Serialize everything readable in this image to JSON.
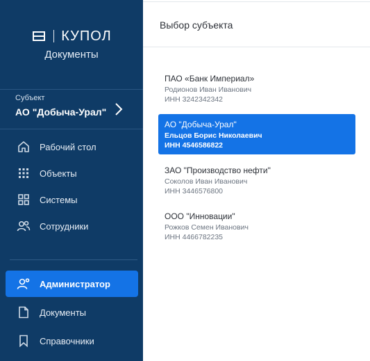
{
  "brand": {
    "name": "КУПОЛ",
    "subtitle": "Документы"
  },
  "subject": {
    "caption": "Субъект",
    "name": "АО \"Добыча-Урал\""
  },
  "nav": {
    "items": [
      {
        "label": "Рабочий стол",
        "icon": "home-icon"
      },
      {
        "label": "Объекты",
        "icon": "grid-dots-icon"
      },
      {
        "label": "Системы",
        "icon": "systems-icon"
      },
      {
        "label": "Сотрудники",
        "icon": "people-icon"
      }
    ],
    "bottom_items": [
      {
        "label": "Администратор",
        "icon": "admin-icon",
        "active": true
      },
      {
        "label": "Документы",
        "icon": "document-icon"
      },
      {
        "label": "Справочники",
        "icon": "bookmark-icon"
      }
    ]
  },
  "panel": {
    "title": "Выбор субъекта",
    "entities": [
      {
        "name": "ПАО «Банк Империал»",
        "person": "Родионов Иван Иванович",
        "inn": "ИНН 3242342342",
        "selected": false
      },
      {
        "name": "АО \"Добыча-Урал\"",
        "person": "Ельцов Борис Николаевич",
        "inn": "ИНН 4546586822",
        "selected": true
      },
      {
        "name": "ЗАО \"Производство нефти\"",
        "person": "Соколов Иван Иванович",
        "inn": "ИНН 3446576800",
        "selected": false
      },
      {
        "name": "ООО \"Инновации\"",
        "person": "Рожков Семен Иванович",
        "inn": "ИНН 4466782235",
        "selected": false
      }
    ]
  },
  "colors": {
    "sidebar": "#0f3b66",
    "accent": "#1473e6",
    "text": "#2b2f36",
    "muted": "#6b7480"
  }
}
